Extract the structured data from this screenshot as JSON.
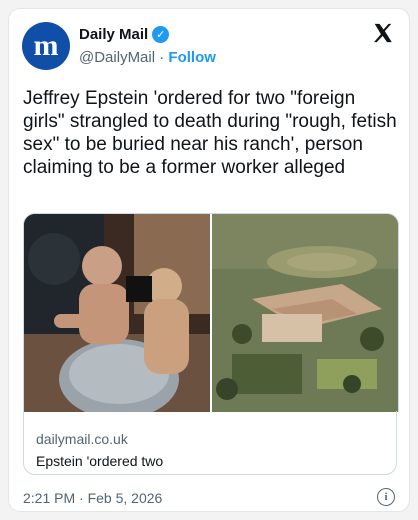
{
  "author": {
    "avatar_letter": "m",
    "name": "Daily Mail",
    "handle": "@DailyMail",
    "separator": "·",
    "follow_label": "Follow",
    "verified_icon": "verified-badge-icon",
    "brand_color": "#0f4fa8"
  },
  "tweet": {
    "text": "Jeffrey Epstein 'ordered for two \"foreign girls\" strangled to death during \"rough, fetish sex\" to be buried near his ranch', person claiming to be a former worker alleged"
  },
  "link_card": {
    "domain": "dailymail.co.uk",
    "title": "Epstein 'ordered two"
  },
  "footer": {
    "timestamp": "2:21 PM · Feb 5, 2026",
    "info_icon": "info-icon"
  },
  "colors": {
    "accent": "#1d9bf0",
    "text": "#0f1419",
    "secondary": "#536471"
  }
}
